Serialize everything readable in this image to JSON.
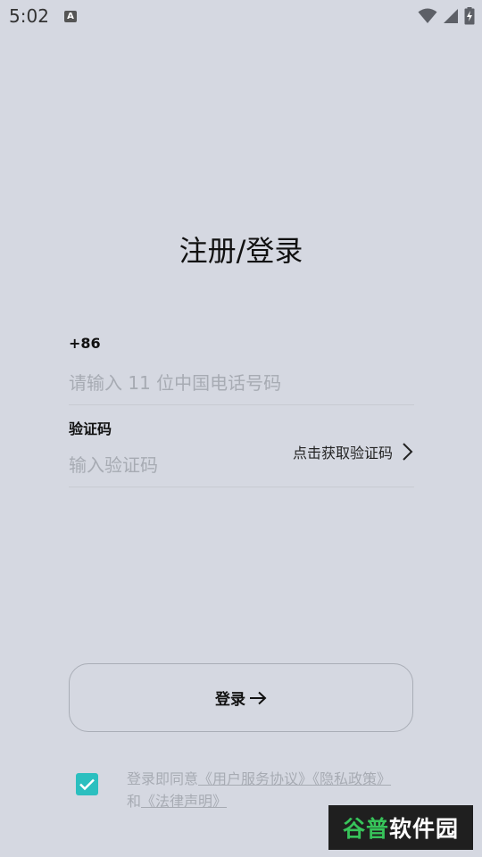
{
  "status_bar": {
    "time": "5:02",
    "notification_letter": "A"
  },
  "title": "注册/登录",
  "phone": {
    "country_code": "+86",
    "placeholder": "请输入 11 位中国电话号码",
    "value": ""
  },
  "code": {
    "label": "验证码",
    "placeholder": "输入验证码",
    "value": "",
    "get_code_label": "点击获取验证码"
  },
  "login": {
    "label": "登录"
  },
  "agreement": {
    "checked": true,
    "prefix": "登录即同意",
    "user_agreement": "《用户服务协议》",
    "privacy_policy": "《隐私政策》",
    "conjunction": "和",
    "legal_statement": "《法律声明》"
  },
  "watermark": {
    "part1": "谷普",
    "part2": "软件园"
  },
  "colors": {
    "background": "#d5d8e1",
    "accent": "#2bbfbf",
    "placeholder": "#a7abb3"
  }
}
